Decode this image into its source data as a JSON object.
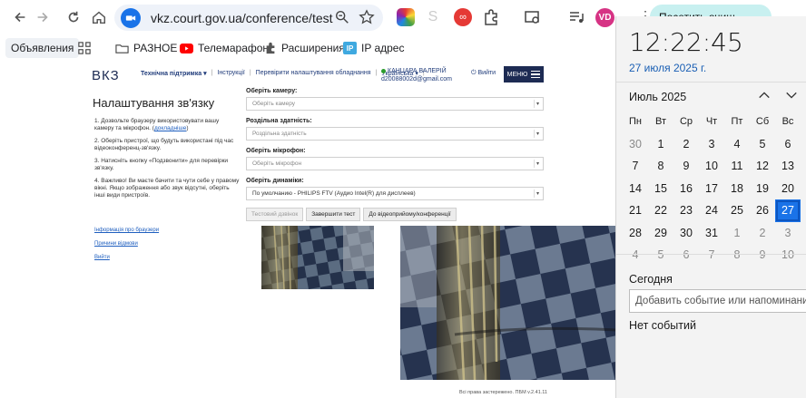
{
  "browser": {
    "url": "vkz.court.gov.ua/conference/test",
    "avatar_initials": "VD",
    "promo_text": "Посетить очищ",
    "bookmarks": [
      {
        "label": "Объявления"
      },
      {
        "label": "РАЗНОЕ"
      },
      {
        "label": "Телемарафон"
      },
      {
        "label": "Расширения"
      },
      {
        "label": "IP адрес"
      }
    ],
    "accent": "#1a73e8"
  },
  "site": {
    "logo": "ВКЗ",
    "nav": [
      "Технічна підтримка ▾",
      "Інструкції",
      "Перевірити налаштування обладнання",
      "Українська ▾"
    ],
    "user_name": "КАНЦАРА ВАЛЕРІЙ",
    "user_email": "d20088002d@gmail.com",
    "logout_label": "Вийти",
    "menu_label": "МЕНЮ",
    "page_title": "Налаштування зв'язку",
    "steps": [
      {
        "num": "1.",
        "text": "Дозвольте браузеру використовувати вашу камеру та мікрофон. (",
        "link": "докладніше",
        "after": ")"
      },
      {
        "num": "2.",
        "text": "Оберіть пристрої, що будуть використані під час відеоконференц-зв'язку.",
        "link": "",
        "after": ""
      },
      {
        "num": "3.",
        "text": "Натисніть кнопку «Подзвонити» для перевірки зв'язку.",
        "link": "",
        "after": ""
      },
      {
        "num": "4.",
        "text": "Важливо! Ви маєте бачити та чути себе у правому вікні. Якщо зображення або звук відсутні, оберіть інші види пристроїв.",
        "link": "",
        "after": ""
      }
    ],
    "side_links": [
      "Інформація про браузери",
      "Причини відмови",
      "Вийти"
    ],
    "form": {
      "camera_label": "Оберіть камеру:",
      "camera_placeholder": "Оберіть камеру",
      "resolution_label": "Роздільна здатність:",
      "resolution_placeholder": "Роздільна здатність",
      "mic_label": "Оберіть мікрофон:",
      "mic_placeholder": "Оберіть мікрофон",
      "speaker_label": "Оберіть динаміки:",
      "speaker_value": "По умолчанию - PHILIPS FTV (Аудио Intel(R) для дисплеев)",
      "btn_test": "Тестовий дзвінок",
      "btn_finish": "Завершити тест",
      "btn_go": "До відеоприйому/конференції"
    },
    "copyright": "Всі права застережено. ПБМ v.2.41.11"
  },
  "calendar": {
    "time": "12:22:45",
    "date": "27 июля 2025 г.",
    "month": "Июль 2025",
    "weekdays": [
      "Пн",
      "Вт",
      "Ср",
      "Чт",
      "Пт",
      "Сб",
      "Вс"
    ],
    "days": [
      [
        "30",
        "1",
        "2",
        "3",
        "4",
        "5",
        "6"
      ],
      [
        "7",
        "8",
        "9",
        "10",
        "11",
        "12",
        "13"
      ],
      [
        "14",
        "15",
        "16",
        "17",
        "18",
        "19",
        "20"
      ],
      [
        "21",
        "22",
        "23",
        "24",
        "25",
        "26",
        "27"
      ],
      [
        "28",
        "29",
        "30",
        "31",
        "1",
        "2",
        "3"
      ],
      [
        "4",
        "5",
        "6",
        "7",
        "8",
        "9",
        "10"
      ]
    ],
    "today_label": "Сегодня",
    "add_event_placeholder": "Добавить событие или напоминание",
    "no_events": "Нет событий",
    "selected_day": "27"
  }
}
